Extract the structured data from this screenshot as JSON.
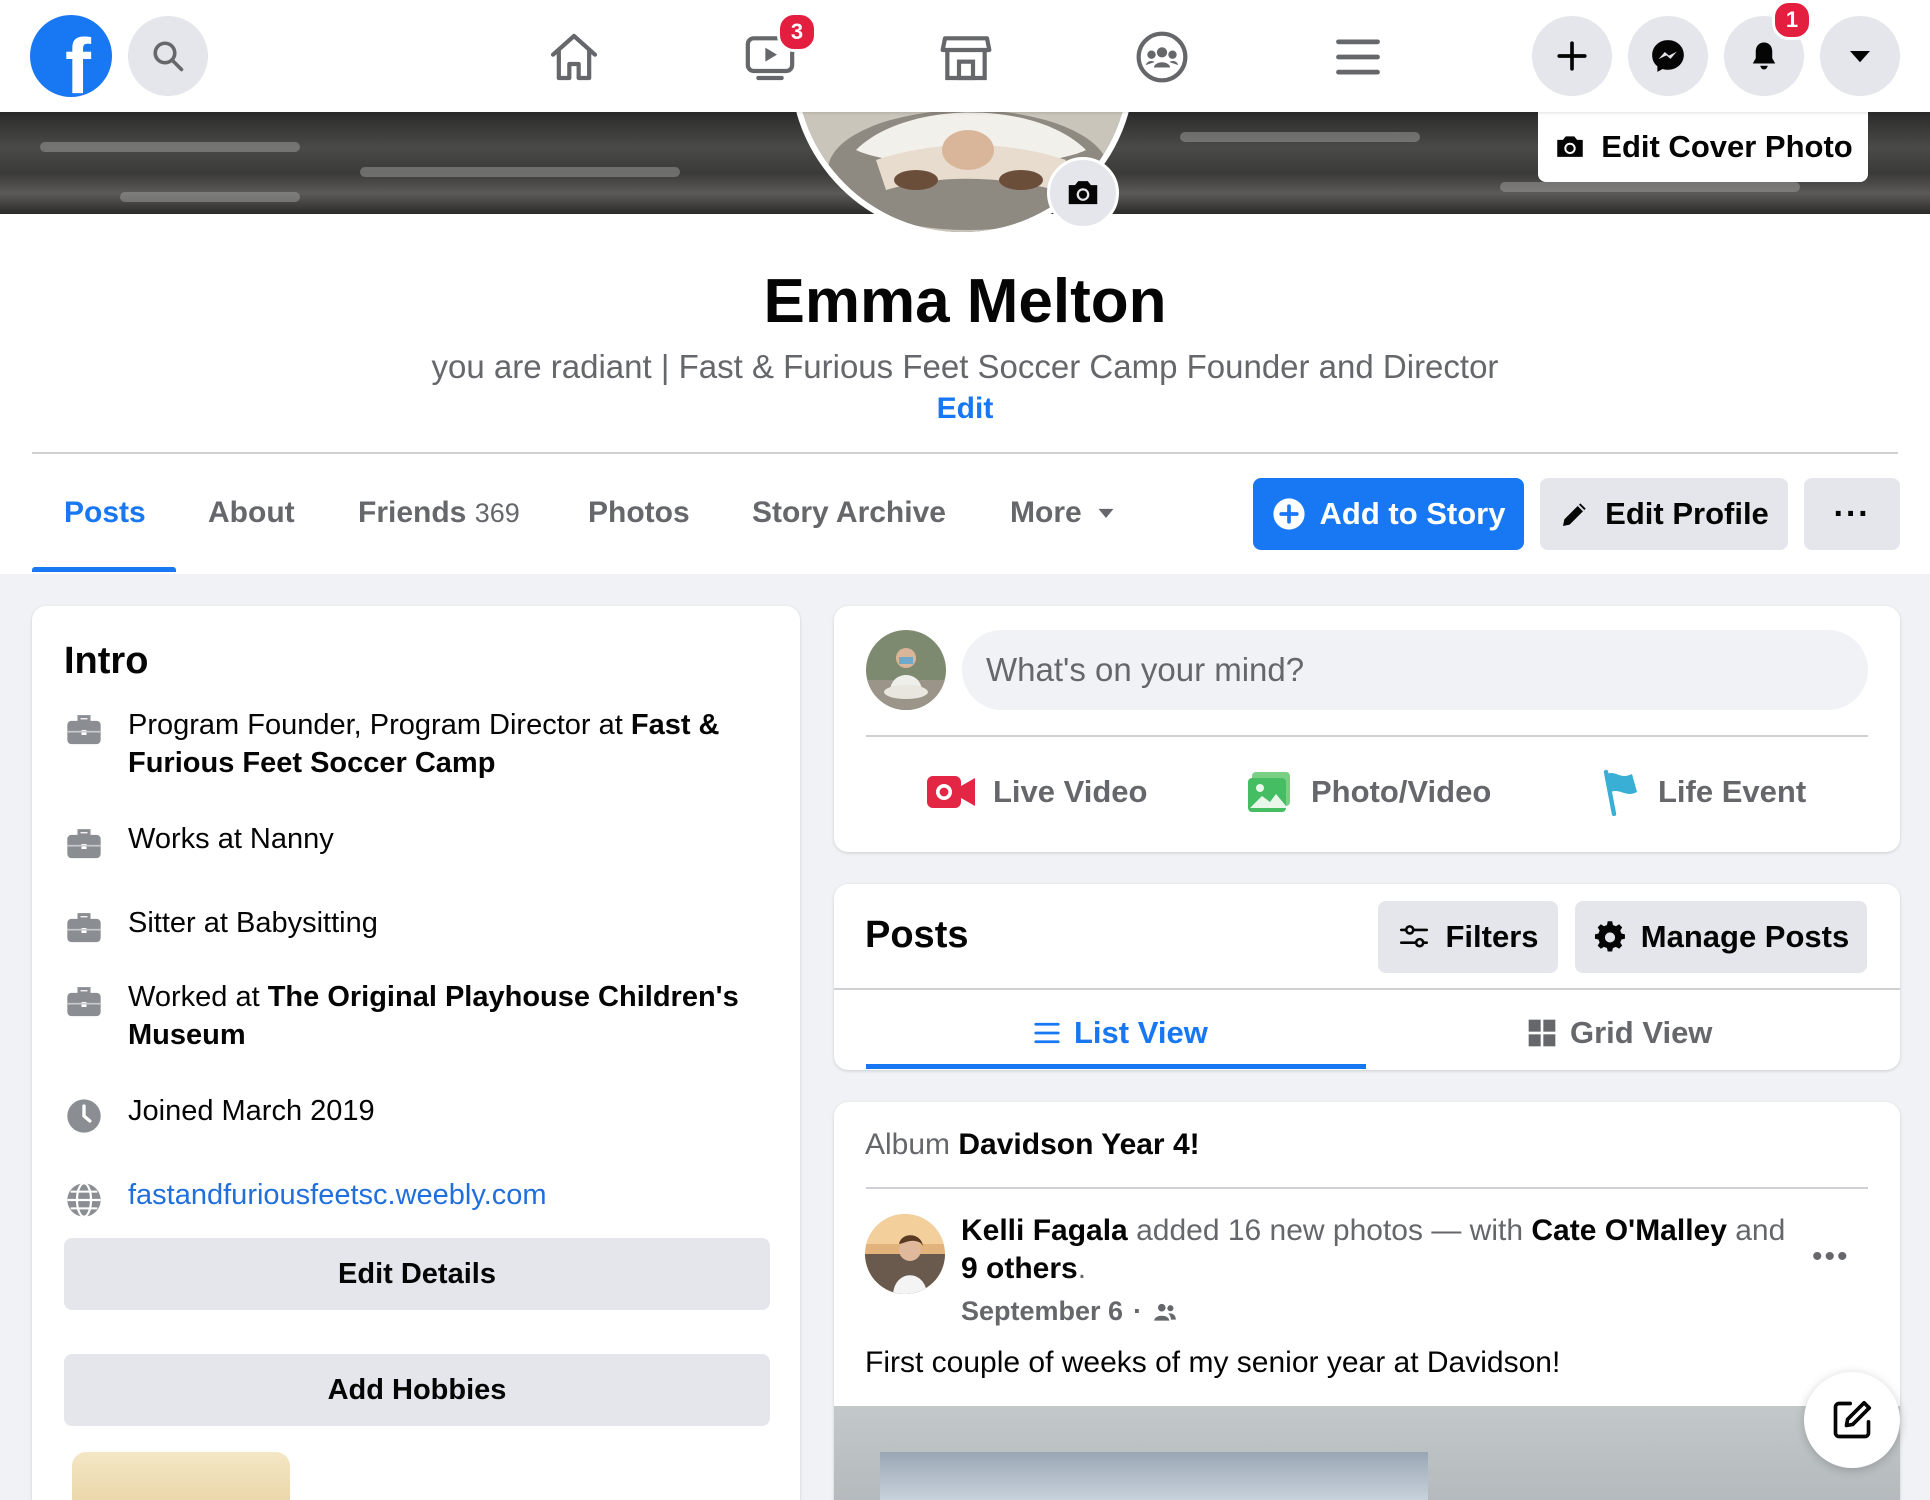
{
  "nav": {
    "logo": "f",
    "icons": {
      "search": "search-icon",
      "home": "home-icon",
      "watch": "watch-icon",
      "marketplace": "marketplace-icon",
      "groups": "groups-icon",
      "menu": "menu-icon",
      "create": "plus-icon",
      "messenger": "messenger-icon",
      "notifications": "bell-icon",
      "account": "caret-down-icon"
    },
    "watch_badge": "3",
    "notifications_badge": "1"
  },
  "cover": {
    "edit_cover_label": "Edit Cover Photo"
  },
  "profile": {
    "name": "Emma Melton",
    "bio": "you are radiant | Fast & Furious Feet Soccer Camp Founder and Director",
    "bio_edit": "Edit"
  },
  "tabs": {
    "posts": "Posts",
    "about": "About",
    "friends": "Friends",
    "friends_count": "369",
    "photos": "Photos",
    "story_archive": "Story Archive",
    "more": "More"
  },
  "actions": {
    "add_to_story": "Add to Story",
    "edit_profile": "Edit Profile",
    "more_dots": "···"
  },
  "intro": {
    "title": "Intro",
    "items": [
      {
        "prefix": "Program Founder, Program Director at ",
        "bold": "Fast & Furious Feet Soccer Camp"
      },
      {
        "text": "Works at Nanny"
      },
      {
        "text": "Sitter at Babysitting"
      },
      {
        "prefix": "Worked at ",
        "bold": "The Original Playhouse Children's Museum"
      },
      {
        "text": "Joined March 2019"
      },
      {
        "link": "fastandfuriousfeetsc.weebly.com"
      }
    ],
    "edit_details": "Edit Details",
    "add_hobbies": "Add Hobbies"
  },
  "composer": {
    "placeholder": "What's on your mind?",
    "live_video": "Live Video",
    "photo_video": "Photo/Video",
    "life_event": "Life Event"
  },
  "posts_section": {
    "title": "Posts",
    "filters": "Filters",
    "manage_posts": "Manage Posts",
    "list_view": "List View",
    "grid_view": "Grid View"
  },
  "post": {
    "album_prefix": "Album",
    "album_name": "Davidson Year 4!",
    "author": "Kelli Fagala",
    "action": "added 16 new photos — with",
    "tagged": "Cate O'Malley",
    "and": "and",
    "others": "9 others",
    "period": ".",
    "date": "September 6",
    "separator": "·",
    "more": "•••",
    "body": "First couple of weeks of my senior year at Davidson!"
  },
  "colors": {
    "brand_blue": "#1877f2",
    "badge_red": "#e41e3f",
    "gray_button": "#e4e6eb",
    "page_bg": "#f0f2f5"
  }
}
